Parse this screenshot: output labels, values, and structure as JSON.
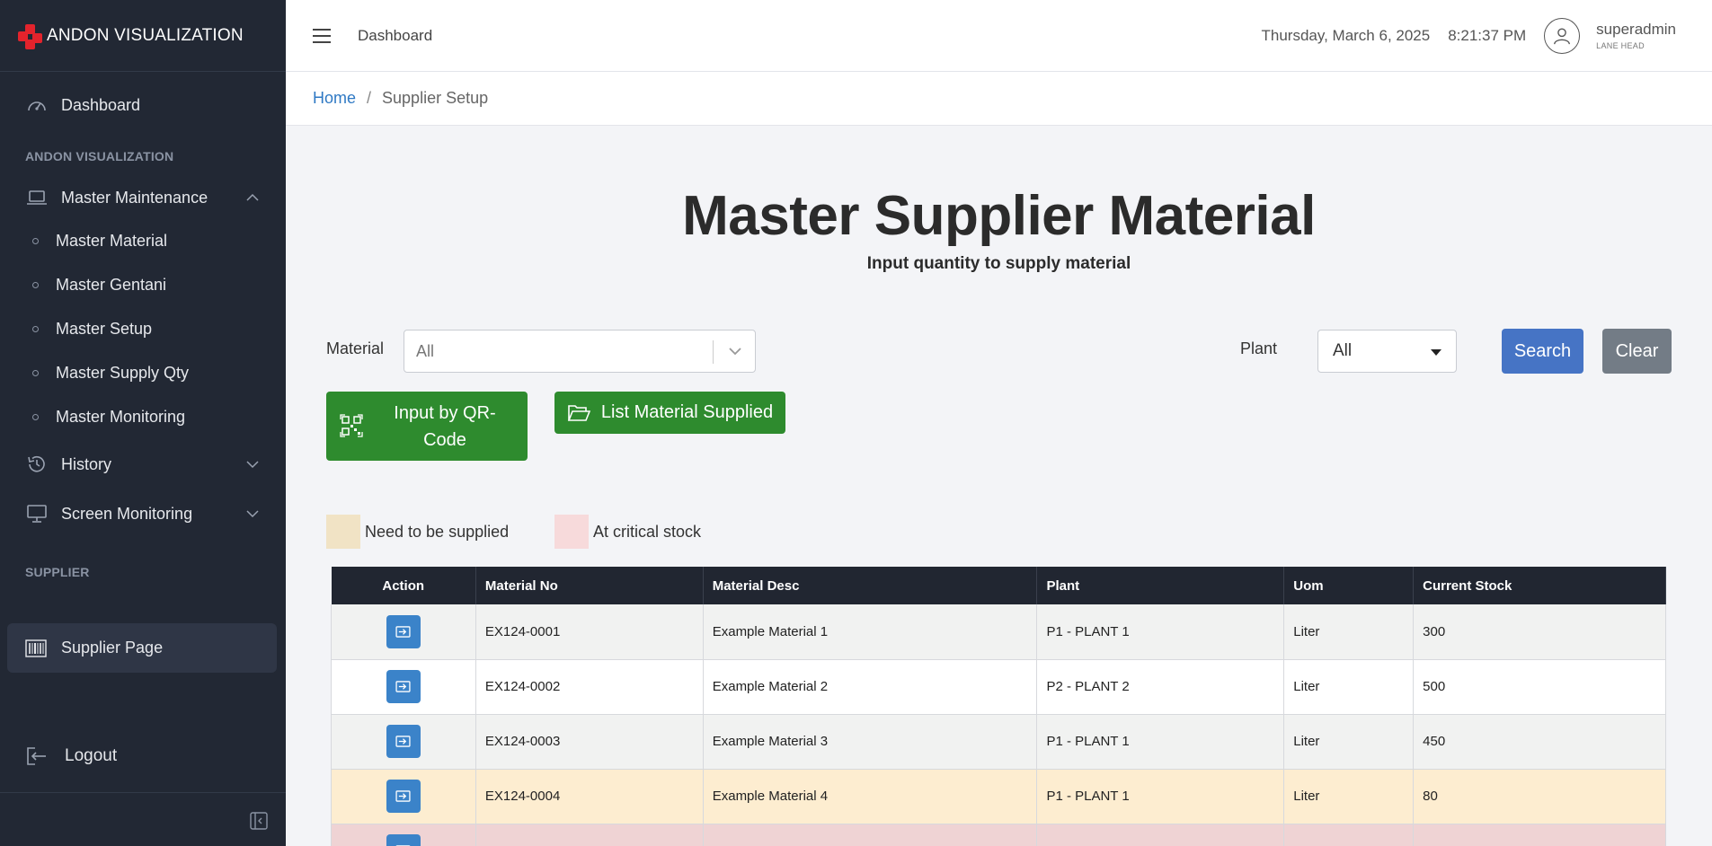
{
  "brand": {
    "title": "ANDON VISUALIZATION"
  },
  "sidebar": {
    "dashboard": "Dashboard",
    "section_andon": "ANDON VISUALIZATION",
    "master_maintenance": "Master Maintenance",
    "sub_items": [
      "Master Material",
      "Master Gentani",
      "Master Setup",
      "Master Supply Qty",
      "Master Monitoring"
    ],
    "history": "History",
    "screen_monitoring": "Screen Monitoring",
    "section_supplier": "SUPPLIER",
    "supplier_page": "Supplier Page",
    "logout": "Logout"
  },
  "topbar": {
    "title": "Dashboard",
    "date": "Thursday, March 6, 2025",
    "time": "8:21:37 PM",
    "user_name": "superadmin",
    "user_role": "LANE HEAD"
  },
  "breadcrumb": {
    "home": "Home",
    "separator": "/",
    "current": "Supplier Setup"
  },
  "page": {
    "title": "Master Supplier Material",
    "subtitle": "Input quantity to supply material"
  },
  "filters": {
    "material_label": "Material",
    "material_value": "All",
    "plant_label": "Plant",
    "plant_value": "All",
    "search_label": "Search",
    "clear_label": "Clear"
  },
  "actions": {
    "qr_label": "Input by QR-Code",
    "list_label": "List Material Supplied"
  },
  "legend": {
    "need": {
      "label": "Need to be supplied",
      "color": "#f1e3c5"
    },
    "critical": {
      "label": "At critical stock",
      "color": "#f7dadb"
    }
  },
  "table": {
    "headers": [
      "Action",
      "Material No",
      "Material Desc",
      "Plant",
      "Uom",
      "Current Stock"
    ],
    "rows": [
      {
        "material_no": "EX124-0001",
        "desc": "Example Material 1",
        "plant": "P1 - PLANT 1",
        "uom": "Liter",
        "stock": "300",
        "status": "alt"
      },
      {
        "material_no": "EX124-0002",
        "desc": "Example Material 2",
        "plant": "P2 - PLANT 2",
        "uom": "Liter",
        "stock": "500",
        "status": "plain"
      },
      {
        "material_no": "EX124-0003",
        "desc": "Example Material 3",
        "plant": "P1 - PLANT 1",
        "uom": "Liter",
        "stock": "450",
        "status": "alt"
      },
      {
        "material_no": "EX124-0004",
        "desc": "Example Material 4",
        "plant": "P1 - PLANT 1",
        "uom": "Liter",
        "stock": "80",
        "status": "need"
      },
      {
        "material_no": "",
        "desc": "",
        "plant": "",
        "uom": "",
        "stock": "",
        "status": "critical"
      }
    ]
  },
  "colors": {
    "sidebar_bg": "#222834",
    "primary": "#4674c5",
    "success": "#2e8b2e",
    "logo_red": "#e3232c"
  }
}
